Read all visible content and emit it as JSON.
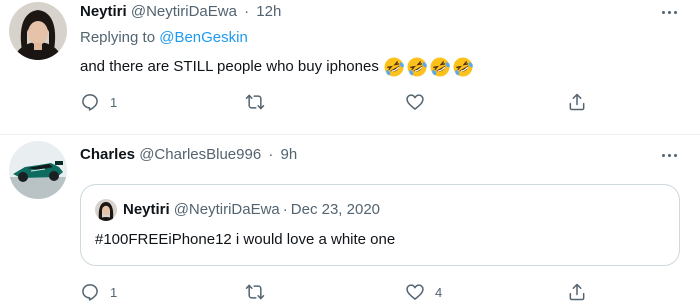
{
  "tweet1": {
    "author_name": "Neytiri",
    "author_handle": "@NeytiriDaEwa",
    "separator": "·",
    "time": "12h",
    "replying_prefix": "Replying to",
    "replying_to": "@BenGeskin",
    "text": "and there are STILL people who buy iphones",
    "emojis": [
      "rolling-on-floor-laughing",
      "rolling-on-floor-laughing",
      "rolling-on-floor-laughing",
      "rolling-on-floor-laughing"
    ],
    "reply_count": "1",
    "retweet_count": "",
    "like_count": ""
  },
  "tweet2": {
    "author_name": "Charles",
    "author_handle": "@CharlesBlue996",
    "separator": "·",
    "time": "9h",
    "reply_count": "1",
    "retweet_count": "",
    "like_count": "4",
    "quoted": {
      "author_name": "Neytiri",
      "author_handle": "@NeytiriDaEwa",
      "separator": "·",
      "date": "Dec 23, 2020",
      "text": "#100FREEiPhone12 i would love a white one"
    }
  },
  "icons": {
    "reply": "reply-icon",
    "retweet": "retweet-icon",
    "like": "heart-icon",
    "share": "share-icon",
    "more": "more-icon"
  },
  "colors": {
    "link": "#1d9bf0",
    "secondary_text": "#536471",
    "primary_text": "#0f1419",
    "border": "#cfd9de"
  }
}
